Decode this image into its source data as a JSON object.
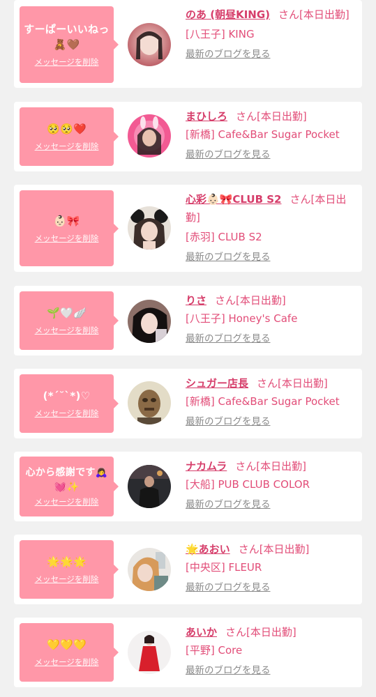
{
  "delete_label": "メッセージを削除",
  "blog_label": "最新のブログを見る",
  "san_suffix": "さん[本日出勤]",
  "accent_color": "#ff97a8",
  "name_color": "#d63d6a",
  "cards": [
    {
      "message": "すーぱーいいねっ\n🧸🤎",
      "name": "のあ (朝昼KING)",
      "shop": "[八王子] KING"
    },
    {
      "message": "🥺🥺❤️",
      "name": "まひしろ",
      "shop": "[新橋] Cafe&Bar Sugar Pocket"
    },
    {
      "message": "👶🏻🎀",
      "name": "心彩👶🏻🎀CLUB S2",
      "shop": "[赤羽] CLUB S2"
    },
    {
      "message": "🌱🤍🪽",
      "name": "りさ",
      "shop": "[八王子] Honey's Cafe"
    },
    {
      "message": "(*´˘`*)♡",
      "name": "シュガー店長",
      "shop": "[新橋] Cafe&Bar Sugar Pocket"
    },
    {
      "message": "心から感謝です🙇‍♀️\n💓✨",
      "name": "ナカムラ",
      "shop": "[大船] PUB CLUB COLOR"
    },
    {
      "message": "🌟🌟🌟",
      "name": "🌟あおい",
      "shop": "[中央区] FLEUR"
    },
    {
      "message": "💛💛💛",
      "name": "あいか",
      "shop": "[平野] Core"
    }
  ]
}
